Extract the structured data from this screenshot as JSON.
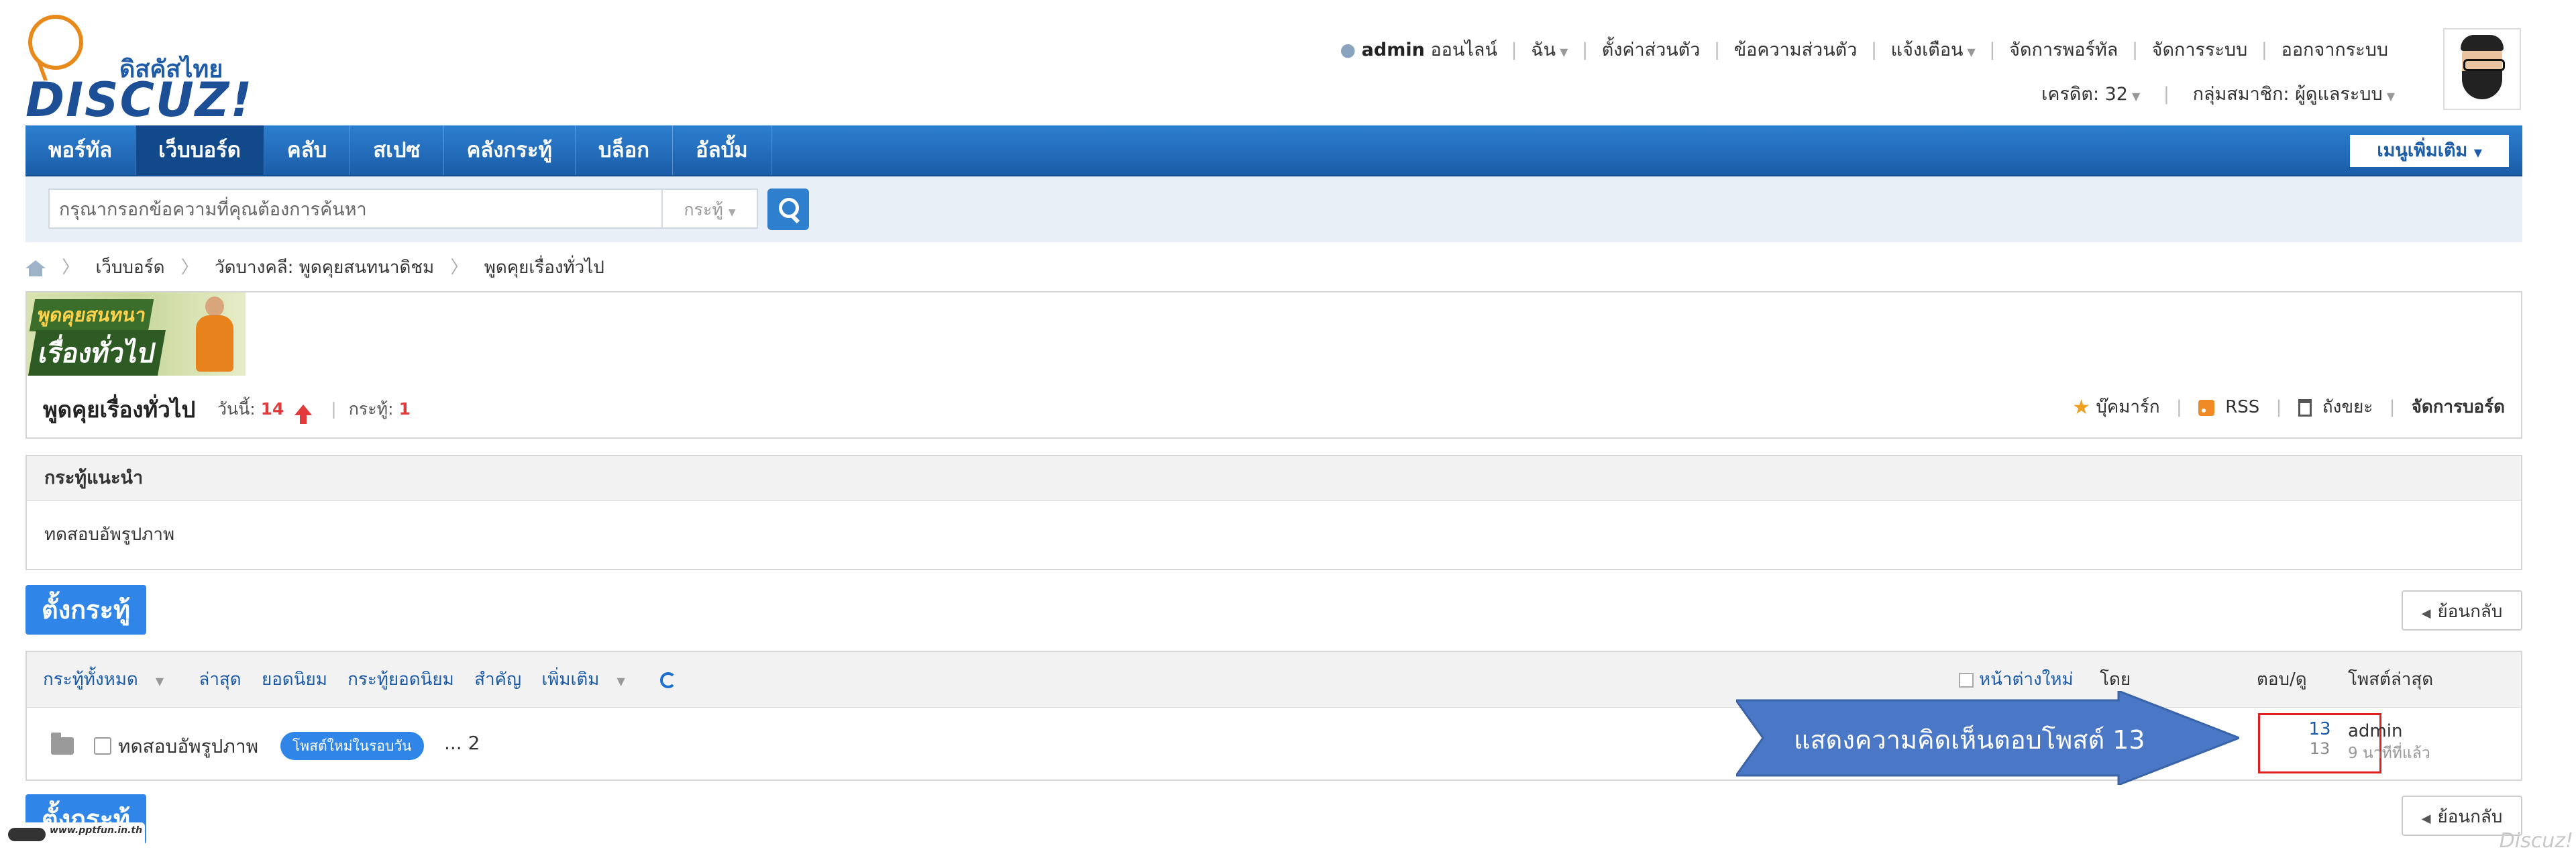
{
  "logo": {
    "thai": "ดิสคัสไทย",
    "word": "DISCUZ!"
  },
  "userbar": {
    "username": "admin",
    "status": "ออนไลน์",
    "links": [
      "ฉัน",
      "ตั้งค่าส่วนตัว",
      "ข้อความส่วนตัว",
      "แจ้งเตือน",
      "จัดการพอร์ทัล",
      "จัดการระบบ",
      "ออกจากระบบ"
    ],
    "credit_label": "เครดิต: 32",
    "group_label": "กลุ่มสมาชิก: ผู้ดูแลระบบ"
  },
  "nav": {
    "items": [
      "พอร์ทัล",
      "เว็บบอร์ด",
      "คลับ",
      "สเปซ",
      "คลังกระทู้",
      "บล็อก",
      "อัลบั้ม"
    ],
    "active_index": 1,
    "more_menu": "เมนูเพิ่มเติม"
  },
  "search": {
    "placeholder": "กรุณากรอกข้อความที่คุณต้องการค้นหา",
    "type": "กระทู้"
  },
  "breadcrumb": [
    "เว็บบอร์ด",
    "วัดบางคลี: พูดคุยสนทนาดิชม",
    "พูดคุยเรื่องทั่วไป"
  ],
  "banner": {
    "line1": "พูดคุยสนทนา",
    "line2": "เรื่องทั่วไป"
  },
  "forum": {
    "title": "พูดคุยเรื่องทั่วไป",
    "today_label": "วันนี้:",
    "today_value": "14",
    "threads_label": "กระทู้:",
    "threads_value": "1",
    "actions": [
      "บุ๊คมาร์ก",
      "RSS",
      "ถังขยะ",
      "จัดการบอร์ด"
    ]
  },
  "recommended": {
    "header": "กระทู้แนะนำ",
    "items": [
      "ทดสอบอัพรูปภาพ"
    ]
  },
  "buttons": {
    "new_thread": "ตั้งกระทู้",
    "back": "ย้อนกลับ"
  },
  "thread_list": {
    "filters": [
      "กระทู้ทั้งหมด",
      "ล่าสุด",
      "ยอดนิยม",
      "กระทู้ยอดนิยม",
      "สำคัญ",
      "เพิ่มเติม"
    ],
    "new_window": "หน้าต่างใหม่",
    "col_by": "โดย",
    "col_replies_views": "ตอบ/ดู",
    "col_last_post": "โพสต์ล่าสุด",
    "rows": [
      {
        "title": "ทดสอบอัพรูปภาพ",
        "badge": "โพสต์ใหม่ในรอบวัน",
        "pages": "... 2",
        "replies": "13",
        "views": "13",
        "last_user": "admin",
        "last_time": "9 นาทีที่แล้ว"
      }
    ]
  },
  "callout": {
    "text": "แสดงความคิดเห็นตอบโพสต์ 13"
  },
  "watermark": {
    "text": "www.pptfun.in.th"
  },
  "footer_logo": "Discuz!",
  "colors": {
    "nav_blue": "#1b5da8",
    "accent_red": "#e02020",
    "button_blue": "#2f86e8"
  }
}
